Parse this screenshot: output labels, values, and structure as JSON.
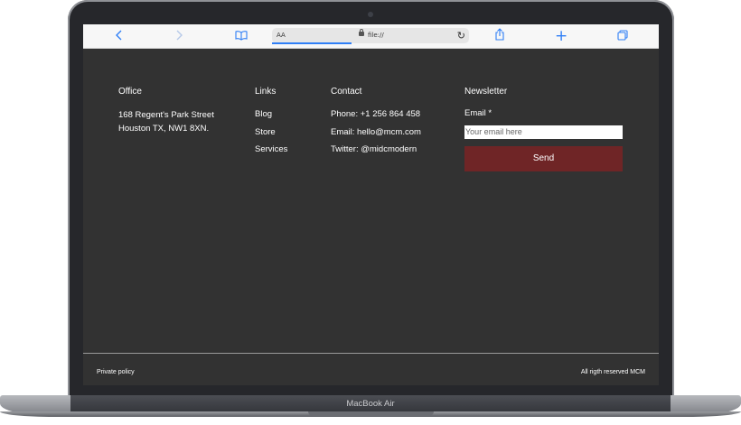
{
  "browser": {
    "reader_label": "AA",
    "url": "file://"
  },
  "footer": {
    "office": {
      "title": "Office",
      "lines": [
        "168 Regent's Park Street",
        "Houston TX, NW1 8XN."
      ]
    },
    "links": {
      "title": "Links",
      "items": [
        "Blog",
        "Store",
        "Services"
      ]
    },
    "contact": {
      "title": "Contact",
      "items": [
        "Phone: +1 256 864 458",
        "Email: hello@mcm.com",
        "Twitter: @midcmodern"
      ]
    },
    "newsletter": {
      "title": "Newsletter",
      "email_label": "Email *",
      "email_placeholder": "Your email here",
      "email_value": "",
      "send_label": "Send"
    },
    "bottom": {
      "privacy_label": "Private policy",
      "rights_label": "All rigth reserved MCM"
    }
  },
  "device": {
    "label": "MacBook Air"
  },
  "colors": {
    "page_bg": "#323232",
    "accent": "#6f2526",
    "browser_icon": "#2f7ff6"
  }
}
